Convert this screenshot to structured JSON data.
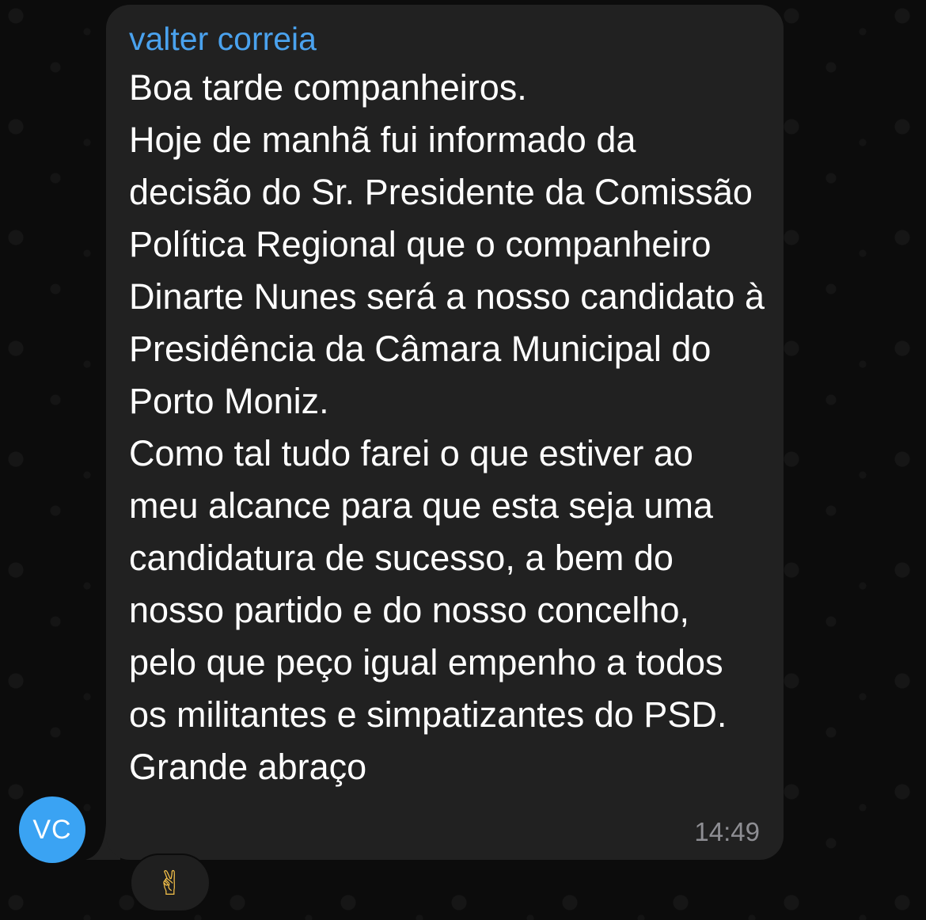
{
  "message": {
    "sender_name": "valter correia",
    "avatar_initials": "VC",
    "text": "Boa tarde companheiros.\nHoje de manhã fui informado da decisão do Sr. Presidente da Comissão Política Regional que o companheiro Dinarte Nunes será a nosso candidato à Presidência da Câmara Municipal do Porto Moniz.\nComo tal tudo farei o que estiver ao meu alcance para que esta seja uma candidatura de sucesso, a bem do nosso partido e do nosso concelho, pelo que peço igual empenho a todos os militantes e simpatizantes do PSD.\nGrande abraço",
    "time": "14:49",
    "reaction": "✌",
    "reaction_icon": "victory-hand-emoji"
  },
  "colors": {
    "bubble": "#212121",
    "sender": "#4aa2ee",
    "avatar": "#3aa3f3",
    "time": "#8e8e93",
    "text": "#ffffff"
  }
}
